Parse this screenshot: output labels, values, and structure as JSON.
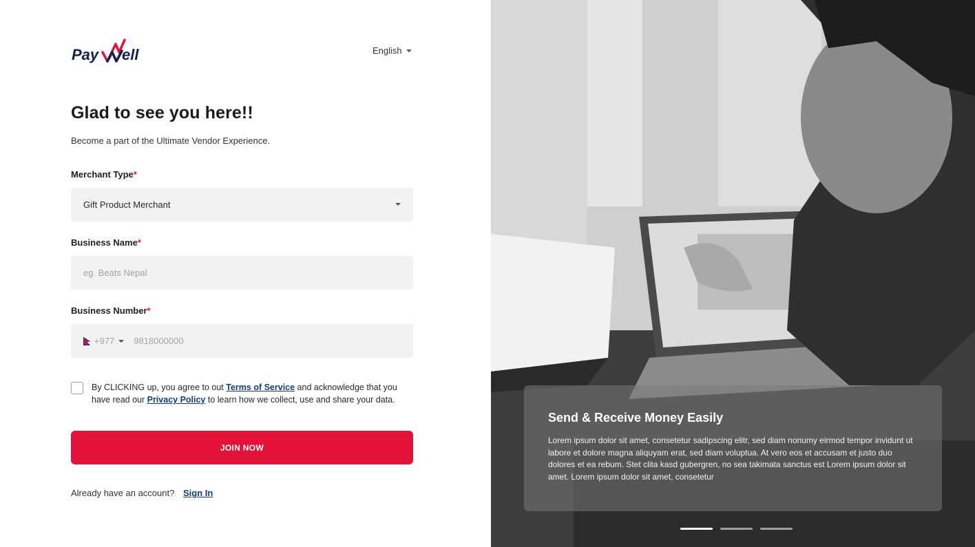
{
  "brand": {
    "logo_text_left": "Pay",
    "logo_text_right": "ell",
    "red": "#e3123a",
    "navy": "#123b82"
  },
  "language": {
    "label": "English"
  },
  "heading": {
    "title": "Glad to see you here!!",
    "subtitle": "Become a part of the Ultimate Vendor Experience."
  },
  "form": {
    "merchant_type": {
      "label": "Merchant Type",
      "required": "*",
      "value": "Gift Product Merchant"
    },
    "business_name": {
      "label": "Business Name",
      "required": "*",
      "placeholder": "eg. Beats Nepal"
    },
    "business_number": {
      "label": "Business Number",
      "required": "*",
      "country_code": "+977",
      "placeholder": "9818000000"
    },
    "terms": {
      "text_1": "By CLICKING up, you agree to out ",
      "terms_link": "Terms of Service",
      "text_2": " and acknowledge that you have read our ",
      "privacy_link": "Privacy Policy",
      "text_3": " to learn how we collect, use and share your data."
    },
    "submit_label": "JOIN NOW"
  },
  "footer": {
    "already": "Already have an account?",
    "signin": "Sign In"
  },
  "slide": {
    "title": "Send & Receive Money Easily",
    "body": "Lorem ipsum dolor sit amet, consetetur sadipscing elitr, sed diam nonumy eirmod tempor invidunt ut labore et dolore magna aliquyam erat, sed diam voluptua. At vero eos et accusam et justo duo dolores et ea rebum. Stet clita kasd gubergren, no sea takimata sanctus est Lorem ipsum dolor sit amet. Lorem ipsum dolor sit amet, consetetur",
    "active_index": 0,
    "count": 3
  }
}
